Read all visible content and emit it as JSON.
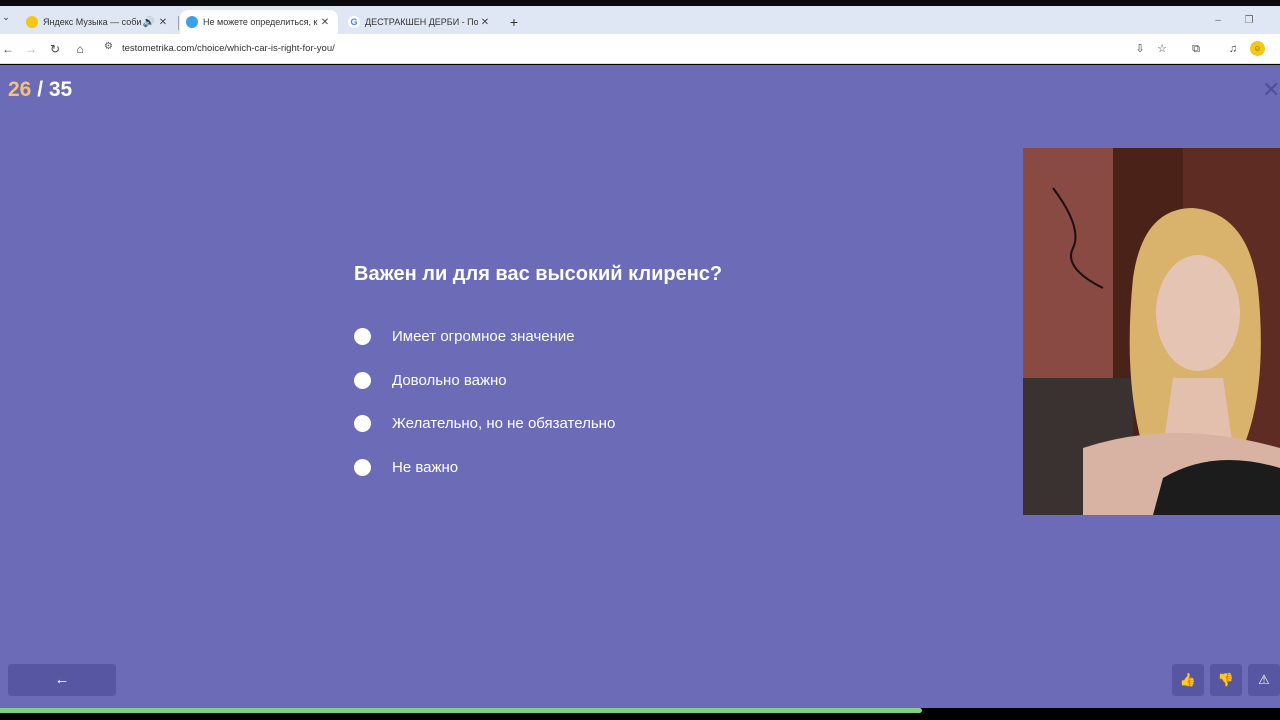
{
  "browser": {
    "tabs": [
      {
        "title": "Яндекс Музыка — собирае",
        "favicon_color": "#f5c518",
        "audio_icon": "🔊",
        "close": "✕",
        "active": false
      },
      {
        "title": "Не можете определиться, как",
        "favicon_color": "#3aa0e8",
        "close": "✕",
        "active": true
      },
      {
        "title": "ДЕСТРАКШЕН ДЕРБИ - Поиск",
        "favicon_color": "#4285f4",
        "favicon_letter": "G",
        "close": "✕",
        "active": false
      }
    ],
    "tab_menu_icon": "⌄",
    "new_tab_icon": "+",
    "window_controls": {
      "minimize": "–",
      "restore": "❐",
      "close": "✕"
    },
    "nav": {
      "back": "←",
      "forward": "→",
      "reload": "↻",
      "home": "⌂"
    },
    "url": "testometrika.com/choice/which-car-is-right-for-you/",
    "toolbar_icons": {
      "install": "⇩",
      "bookmark": "☆",
      "extensions": "⧉",
      "media": "♫",
      "profile": "☺"
    }
  },
  "quiz": {
    "progress": {
      "current": "26",
      "separator": " / ",
      "total": "35",
      "fraction": 0.72
    },
    "close_icon": "✕",
    "question": "Важен ли для вас высокий клиренс?",
    "options": [
      "Имеет огромное значение",
      "Довольно важно",
      "Желательно, но не обязательно",
      "Не важно"
    ],
    "back_icon": "←",
    "feedback": {
      "like": "👍",
      "dislike": "👎",
      "report": "⚠"
    }
  },
  "colors": {
    "page_bg": "#6b6bb8",
    "button_bg": "#5656a2",
    "counter_current": "#f4c07a",
    "progress": "#7fd07f"
  }
}
